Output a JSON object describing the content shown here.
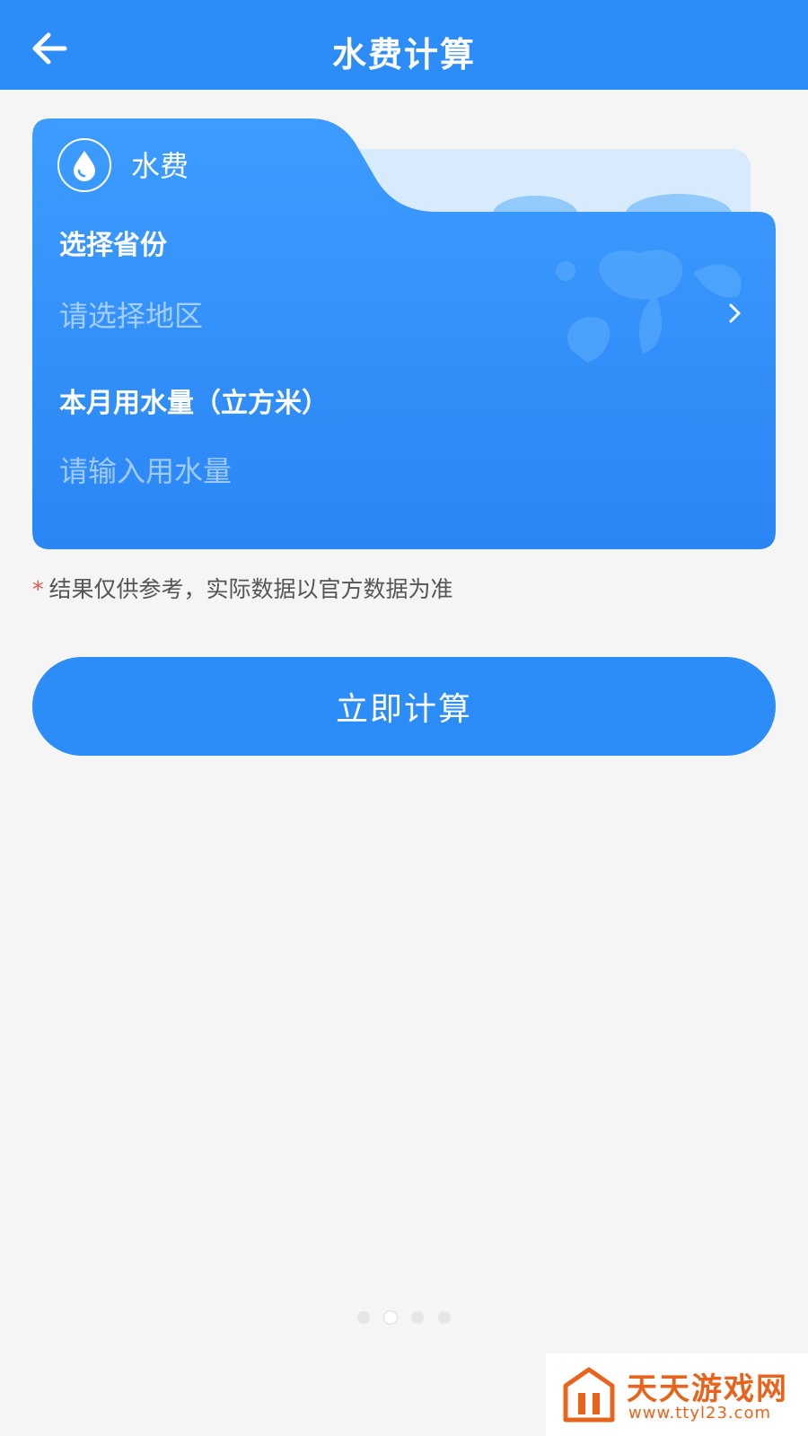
{
  "header": {
    "title": "水费计算",
    "back_icon": "arrow-left-icon"
  },
  "card": {
    "tab_label": "水费",
    "tab_icon": "water-drop-icon",
    "fields": [
      {
        "label": "选择省份",
        "placeholder": "请选择地区",
        "type": "select"
      },
      {
        "label": "本月用水量（立方米）",
        "placeholder": "请输入用水量",
        "type": "input"
      }
    ]
  },
  "note": {
    "marker": "*",
    "text": "结果仅供参考，实际数据以官方数据为准"
  },
  "calc_button": {
    "label": "立即计算"
  },
  "pager": {
    "total": 4,
    "active_index": 1
  },
  "watermark": {
    "title": "天天游戏网",
    "url": "www.ttyl23.com"
  },
  "colors": {
    "primary": "#2c8cf8",
    "background": "#f5f5f5",
    "note_marker": "#e05a4e",
    "watermark": "#e8641d"
  }
}
